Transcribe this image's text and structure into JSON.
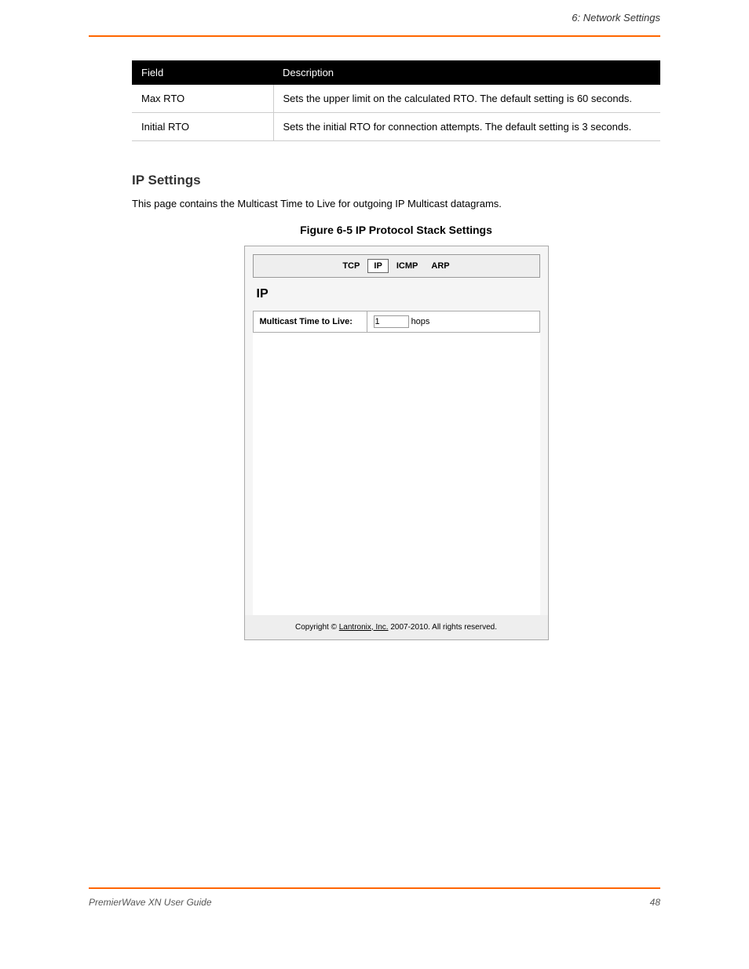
{
  "header": {
    "section_ref": "6: Network Settings"
  },
  "table": {
    "columns": [
      "Field",
      "Description"
    ],
    "rows": [
      {
        "field": "Max RTO",
        "description": "Sets the upper limit on the calculated RTO. The default setting is 60 seconds."
      },
      {
        "field": "Initial RTO",
        "description": "Sets the initial RTO for connection attempts. The default setting is 3 seconds."
      }
    ]
  },
  "ip_section": {
    "heading": "IP Settings",
    "paragraph": "This page contains the Multicast Time to Live for outgoing IP Multicast datagrams.",
    "figure_caption": "Figure 6-5 IP Protocol Stack Settings"
  },
  "figure": {
    "tabs": [
      "TCP",
      "IP",
      "ICMP",
      "ARP"
    ],
    "active_tab": "IP",
    "panel_title": "IP",
    "row_label": "Multicast Time to Live:",
    "input_value": "1",
    "input_suffix": "hops",
    "copyright_prefix": "Copyright © ",
    "copyright_link": "Lantronix, Inc.",
    "copyright_suffix": " 2007-2010. All rights reserved."
  },
  "footer": {
    "left": "PremierWave XN User Guide",
    "right": "48"
  }
}
